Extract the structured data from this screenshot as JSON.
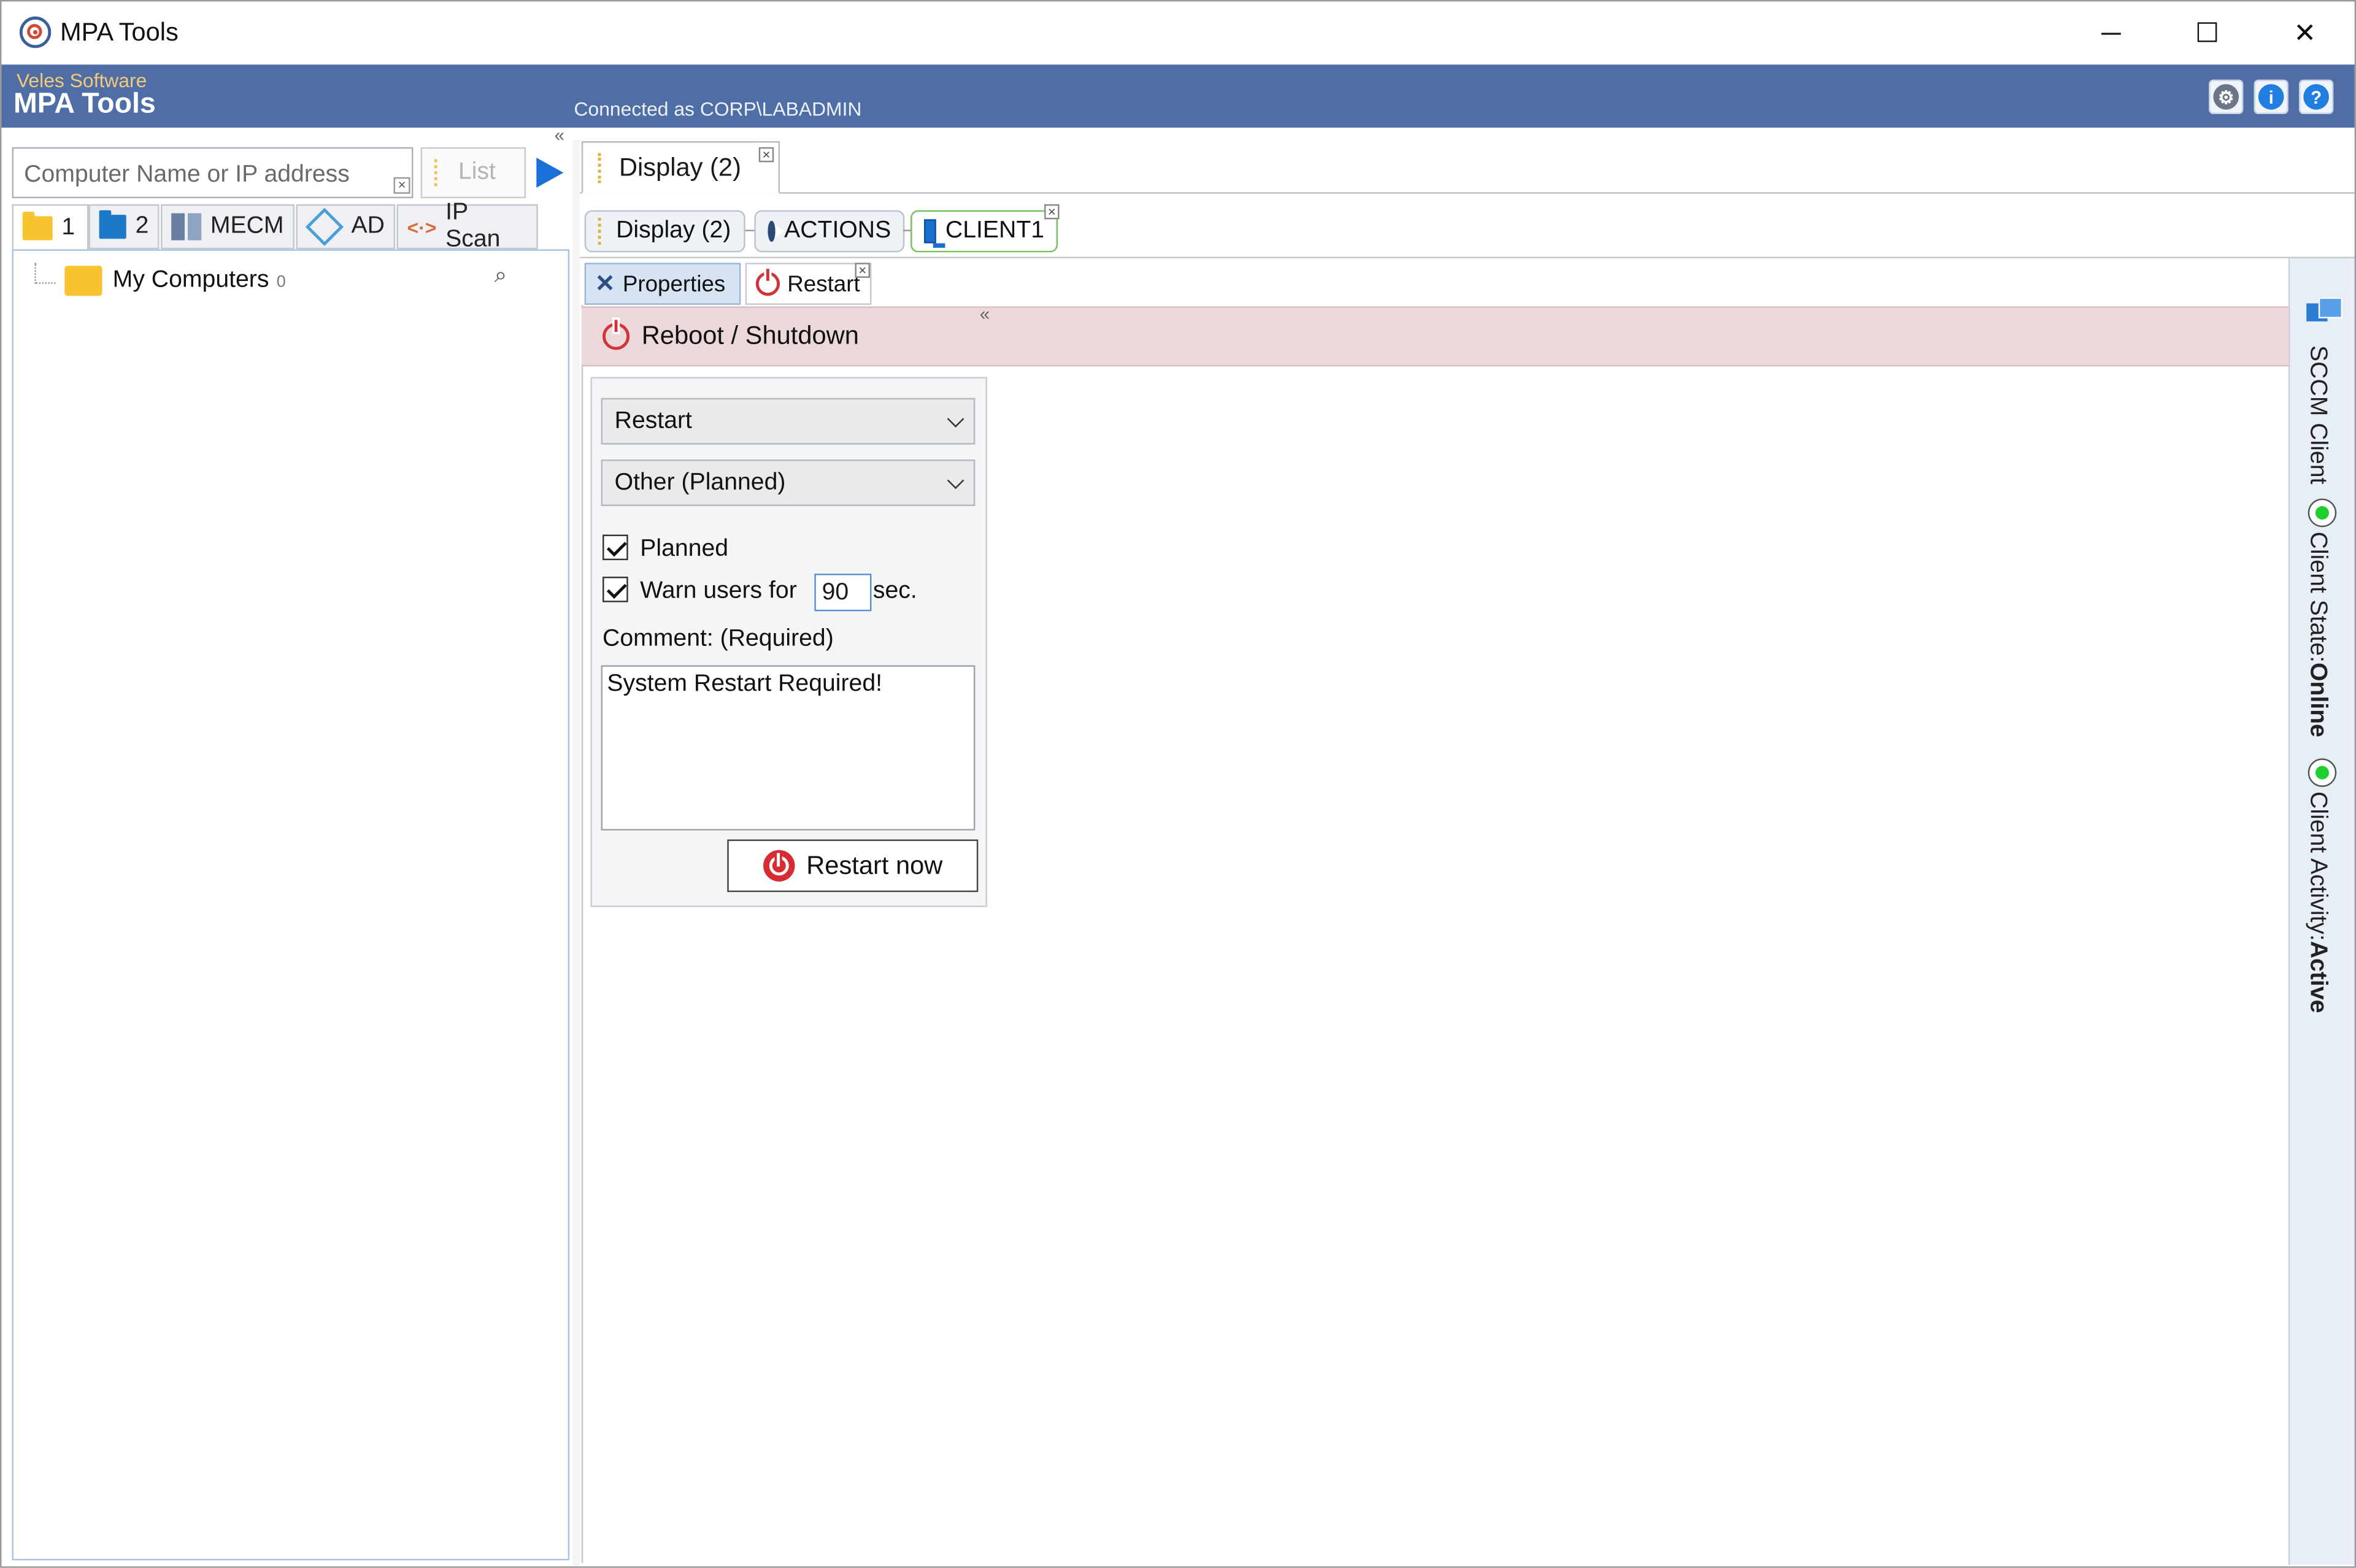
{
  "window": {
    "title": "MPA Tools",
    "controls": {
      "minimize": "─",
      "maximize": "☐",
      "close": "✕"
    }
  },
  "header": {
    "brand_sub": "Veles Software",
    "brand_main": "MPA Tools",
    "connected": "Connected as CORP\\LABADMIN",
    "icons": [
      "gear-icon",
      "info-icon",
      "help-icon"
    ],
    "info_glyph": "i",
    "help_glyph": "?",
    "gear_glyph": "⚙",
    "background_color": "#4f6ea6"
  },
  "left": {
    "collapse": "«",
    "search_placeholder": "Computer Name or IP address",
    "clear_glyph": "×",
    "list_label": "List",
    "tabs": [
      {
        "label": "1",
        "icon": "folder-yellow-icon"
      },
      {
        "label": "2",
        "icon": "folder-blue-icon"
      },
      {
        "label": "MECM",
        "icon": "server-icon"
      },
      {
        "label": "AD",
        "icon": "active-directory-icon"
      },
      {
        "label": "IP Scan",
        "icon": "network-icon"
      }
    ],
    "tree": {
      "label": "My Computers",
      "count": "0"
    }
  },
  "main": {
    "doc_tab": {
      "label": "Display (2)",
      "close": "×"
    },
    "crumbs": [
      {
        "label": "Display (2)"
      },
      {
        "label": "ACTIONS"
      },
      {
        "label": "CLIENT1",
        "close": "×"
      }
    ],
    "subtabs": [
      {
        "label": "Properties"
      },
      {
        "label": "Restart",
        "close": "×"
      }
    ],
    "collapse": "«",
    "section_title": "Reboot / Shutdown",
    "form": {
      "action_select": "Restart",
      "reason_select": "Other (Planned)",
      "planned_label": "Planned",
      "planned_checked": true,
      "warn_label": "Warn users for",
      "warn_checked": true,
      "warn_seconds": "90",
      "warn_unit": "sec.",
      "comment_label": "Comment: (Required)",
      "comment_value": "System Restart Required!",
      "restart_button": "Restart now"
    }
  },
  "side_panel": {
    "title": "SCCM Client",
    "state_label": "Client State:",
    "state_value": "Online",
    "activity_label": "Client Activity:",
    "activity_value": "Active",
    "status_color": "#1ed02e"
  }
}
